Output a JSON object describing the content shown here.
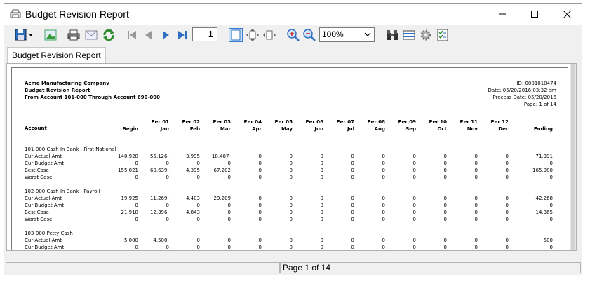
{
  "window": {
    "title": "Budget Revision Report",
    "tab_label": "Budget Revision Report"
  },
  "toolbar": {
    "page_number": "1",
    "zoom_value": "100%"
  },
  "report": {
    "company": "Acme Manufacturing Company",
    "report_name": "Budget Revision Report",
    "range": "From Account 101-000 Through Account 690-000",
    "id_line": "ID: 0001010474",
    "date_line": "Date: 05/20/2016 03:32 pm",
    "process_line": "Process Date: 05/20/2016",
    "page_line": "Page: 1 of 14",
    "columns": {
      "account": "Account",
      "begin": "Begin",
      "per01": [
        "Per 01",
        "Jan"
      ],
      "per02": [
        "Per 02",
        "Feb"
      ],
      "per03": [
        "Per 03",
        "Mar"
      ],
      "per04": [
        "Per 04",
        "Apr"
      ],
      "per05": [
        "Per 05",
        "May"
      ],
      "per06": [
        "Per 06",
        "Jun"
      ],
      "per07": [
        "Per 07",
        "Jul"
      ],
      "per08": [
        "Per 08",
        "Aug"
      ],
      "per09": [
        "Per 09",
        "Sep"
      ],
      "per10": [
        "Per 10",
        "Oct"
      ],
      "per11": [
        "Per 11",
        "Nov"
      ],
      "per12": [
        "Per 12",
        "Dec"
      ],
      "ending": "Ending"
    },
    "sections": [
      {
        "title": "101-000 Cash In Bank - First National",
        "rows": [
          {
            "label": "Cur Actual Amt",
            "values": [
              "140,928",
              "55,126-",
              "3,995",
              "18,407-",
              "0",
              "0",
              "0",
              "0",
              "0",
              "0",
              "0",
              "0",
              "0",
              "71,391"
            ]
          },
          {
            "label": "Cur Budget Amt",
            "values": [
              "0",
              "0",
              "0",
              "0",
              "0",
              "0",
              "0",
              "0",
              "0",
              "0",
              "0",
              "0",
              "0",
              "0"
            ]
          },
          {
            "label": "Best Case",
            "values": [
              "155,021",
              "60,639-",
              "4,395",
              "67,202",
              "0",
              "0",
              "0",
              "0",
              "0",
              "0",
              "0",
              "0",
              "0",
              "165,980"
            ]
          },
          {
            "label": "Worst Case",
            "values": [
              "0",
              "0",
              "0",
              "0",
              "0",
              "0",
              "0",
              "0",
              "0",
              "0",
              "0",
              "0",
              "0",
              "0"
            ]
          }
        ]
      },
      {
        "title": "102-000 Cash In Bank - Payroll",
        "rows": [
          {
            "label": "Cur Actual Amt",
            "values": [
              "19,925",
              "11,269-",
              "4,403",
              "29,209",
              "0",
              "0",
              "0",
              "0",
              "0",
              "0",
              "0",
              "0",
              "0",
              "42,268"
            ]
          },
          {
            "label": "Cur Budget Amt",
            "values": [
              "0",
              "0",
              "0",
              "0",
              "0",
              "0",
              "0",
              "0",
              "0",
              "0",
              "0",
              "0",
              "0",
              "0"
            ]
          },
          {
            "label": "Best Case",
            "values": [
              "21,918",
              "12,396-",
              "4,843",
              "0",
              "0",
              "0",
              "0",
              "0",
              "0",
              "0",
              "0",
              "0",
              "0",
              "14,365"
            ]
          },
          {
            "label": "Worst Case",
            "values": [
              "0",
              "0",
              "0",
              "0",
              "0",
              "0",
              "0",
              "0",
              "0",
              "0",
              "0",
              "0",
              "0",
              "0"
            ]
          }
        ]
      },
      {
        "title": "103-000 Petty Cash",
        "rows": [
          {
            "label": "Cur Actual Amt",
            "values": [
              "5,000",
              "4,500-",
              "0",
              "0",
              "0",
              "0",
              "0",
              "0",
              "0",
              "0",
              "0",
              "0",
              "0",
              "500"
            ]
          },
          {
            "label": "Cur Budget Amt",
            "values": [
              "0",
              "0",
              "0",
              "0",
              "0",
              "0",
              "0",
              "0",
              "0",
              "0",
              "0",
              "0",
              "0",
              "0"
            ]
          }
        ]
      }
    ]
  },
  "status": {
    "page_text": "Page 1 of 14"
  },
  "colors": {
    "accent": "#2f6fc2",
    "green": "#3a9a3a",
    "window_bg": "#f0f0f0"
  }
}
